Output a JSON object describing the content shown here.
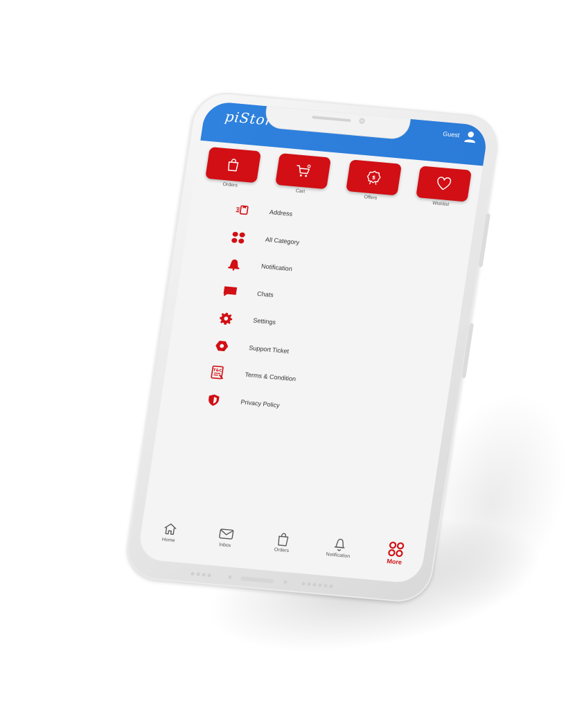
{
  "app": {
    "brand": "piStor",
    "brand_tagline": "",
    "guest_label": "Guest",
    "accent_color": "#d10f14",
    "header_color": "#2f82de"
  },
  "quick_tiles": [
    {
      "label": "Orders",
      "icon": "shopping-bag-icon"
    },
    {
      "label": "Cart",
      "icon": "cart-icon"
    },
    {
      "label": "Offers",
      "icon": "offer-badge-icon"
    },
    {
      "label": "Wishlist",
      "icon": "heart-icon"
    }
  ],
  "menu": [
    {
      "label": "Address",
      "icon": "address-icon"
    },
    {
      "label": "All Category",
      "icon": "category-grid-icon"
    },
    {
      "label": "Notification",
      "icon": "bell-icon"
    },
    {
      "label": "Chats",
      "icon": "chat-bubble-icon"
    },
    {
      "label": "Settings",
      "icon": "gear-icon"
    },
    {
      "label": "Support Ticket",
      "icon": "ticket-icon"
    },
    {
      "label": "Terms & Condition",
      "icon": "terms-icon"
    },
    {
      "label": "Privacy Policy",
      "icon": "shield-icon"
    }
  ],
  "bottom_nav": [
    {
      "label": "Home",
      "icon": "home-icon"
    },
    {
      "label": "Inbox",
      "icon": "inbox-icon"
    },
    {
      "label": "Orders",
      "icon": "shopping-bag-icon"
    },
    {
      "label": "Notification",
      "icon": "bell-icon"
    },
    {
      "label": "More",
      "icon": "more-grid-icon",
      "active": true
    }
  ]
}
